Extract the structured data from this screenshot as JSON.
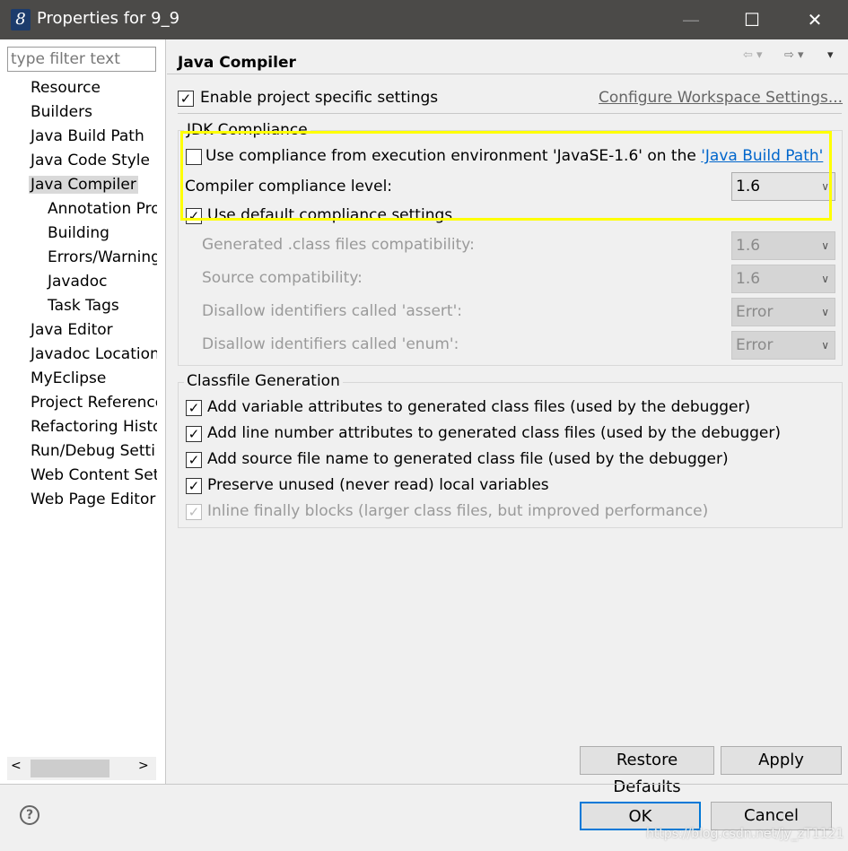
{
  "window": {
    "title": "Properties for 9_9",
    "app_icon": "eclipse-8-icon"
  },
  "sidebar": {
    "filter_placeholder": "type filter text",
    "items": [
      {
        "label": "Resource",
        "level": 0
      },
      {
        "label": "Builders",
        "level": 0
      },
      {
        "label": "Java Build Path",
        "level": 0
      },
      {
        "label": "Java Code Style",
        "level": 0
      },
      {
        "label": "Java Compiler",
        "level": 0,
        "selected": true
      },
      {
        "label": "Annotation Pro",
        "level": 1
      },
      {
        "label": "Building",
        "level": 1
      },
      {
        "label": "Errors/Warning",
        "level": 1
      },
      {
        "label": "Javadoc",
        "level": 1
      },
      {
        "label": "Task Tags",
        "level": 1
      },
      {
        "label": "Java Editor",
        "level": 0
      },
      {
        "label": "Javadoc Location",
        "level": 0
      },
      {
        "label": "MyEclipse",
        "level": 0
      },
      {
        "label": "Project Reference",
        "level": 0
      },
      {
        "label": "Refactoring Histo",
        "level": 0
      },
      {
        "label": "Run/Debug Setti",
        "level": 0
      },
      {
        "label": "Web Content Set",
        "level": 0
      },
      {
        "label": "Web Page Editor",
        "level": 0
      }
    ]
  },
  "main": {
    "title": "Java Compiler",
    "enable_label": "Enable project specific settings",
    "enable_checked": true,
    "configure_link": "Configure Workspace Settings...",
    "jdk": {
      "heading": "JDK Compliance",
      "use_env_label": "Use compliance from execution environment 'JavaSE-1.6' on the ",
      "use_env_link": "'Java Build Path'",
      "use_env_checked": false,
      "level_label": "Compiler compliance level:",
      "level_value": "1.6",
      "default_label": "Use default compliance settings",
      "default_checked": true,
      "rows": [
        {
          "label": "Generated .class files compatibility:",
          "value": "1.6"
        },
        {
          "label": "Source compatibility:",
          "value": "1.6"
        },
        {
          "label": "Disallow identifiers called 'assert':",
          "value": "Error"
        },
        {
          "label": "Disallow identifiers called 'enum':",
          "value": "Error"
        }
      ]
    },
    "classfile": {
      "heading": "Classfile Generation",
      "options": [
        {
          "label": "Add variable attributes to generated class files (used by the debugger)",
          "checked": true,
          "enabled": true
        },
        {
          "label": "Add line number attributes to generated class files (used by the debugger)",
          "checked": true,
          "enabled": true
        },
        {
          "label": "Add source file name to generated class file (used by the debugger)",
          "checked": true,
          "enabled": true
        },
        {
          "label": "Preserve unused (never read) local variables",
          "checked": true,
          "enabled": true
        },
        {
          "label": "Inline finally blocks (larger class files, but improved performance)",
          "checked": true,
          "enabled": false
        }
      ]
    },
    "restore_label": "Restore Defaults",
    "apply_label": "Apply"
  },
  "footer": {
    "ok_label": "OK",
    "cancel_label": "Cancel",
    "watermark": "https://blog.csdn.net/jy_zT1121"
  },
  "colors": {
    "highlight": "#ffff00",
    "link": "#0066cc"
  }
}
